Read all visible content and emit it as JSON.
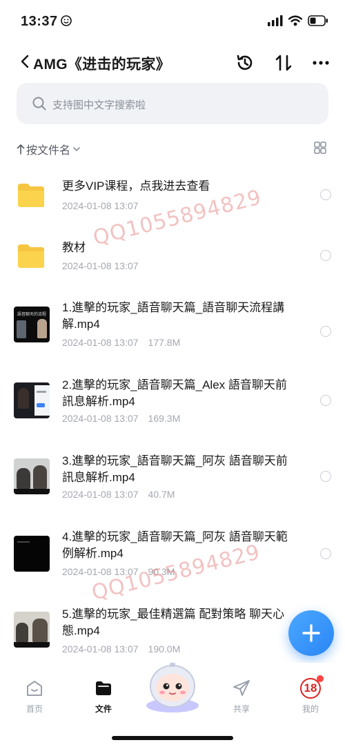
{
  "status_bar": {
    "time": "13:37"
  },
  "nav": {
    "title": "AMG《进击的玩家》"
  },
  "search": {
    "placeholder": "支持图中文字搜索啦"
  },
  "sort": {
    "label": "按文件名"
  },
  "files": [
    {
      "name": "更多VIP课程，点我进去查看",
      "date": "2024-01-08 13:07",
      "size": "",
      "type": "folder"
    },
    {
      "name": "教材",
      "date": "2024-01-08 13:07",
      "size": "",
      "type": "folder"
    },
    {
      "name": "1.進擊的玩家_語音聊天篇_語音聊天流程講解.mp4",
      "date": "2024-01-08 13:07",
      "size": "177.8M",
      "type": "video",
      "thumb_text": "語音聊天的流程"
    },
    {
      "name": "2.進擊的玩家_語音聊天篇_Alex 語音聊天前 訊息解析.mp4",
      "date": "2024-01-08 13:07",
      "size": "169.3M",
      "type": "video"
    },
    {
      "name": "3.進擊的玩家_語音聊天篇_阿灰 語音聊天前 訊息解析.mp4",
      "date": "2024-01-08 13:07",
      "size": "40.7M",
      "type": "video"
    },
    {
      "name": "4.進擊的玩家_語音聊天篇_阿灰 語音聊天範例解析.mp4",
      "date": "2024-01-08 13:07",
      "size": "90.3M",
      "type": "video"
    },
    {
      "name": "5.進擊的玩家_最佳精選篇 配對策略 聊天心態.mp4",
      "date": "2024-01-08 13:07",
      "size": "190.0M",
      "type": "video"
    }
  ],
  "watermark": {
    "text": "QQ1055894829"
  },
  "tabs": [
    {
      "label": "首页",
      "icon": "home-icon",
      "active": false
    },
    {
      "label": "文件",
      "icon": "folder-icon",
      "active": true
    },
    {
      "label": "共享",
      "icon": "share-icon",
      "active": false
    },
    {
      "label": "我的",
      "icon": "profile-icon",
      "active": false
    }
  ],
  "profile_badge": "18",
  "colors": {
    "accent": "#2b86f5",
    "folder": "#fbd34d",
    "watermark": "#e27878"
  }
}
